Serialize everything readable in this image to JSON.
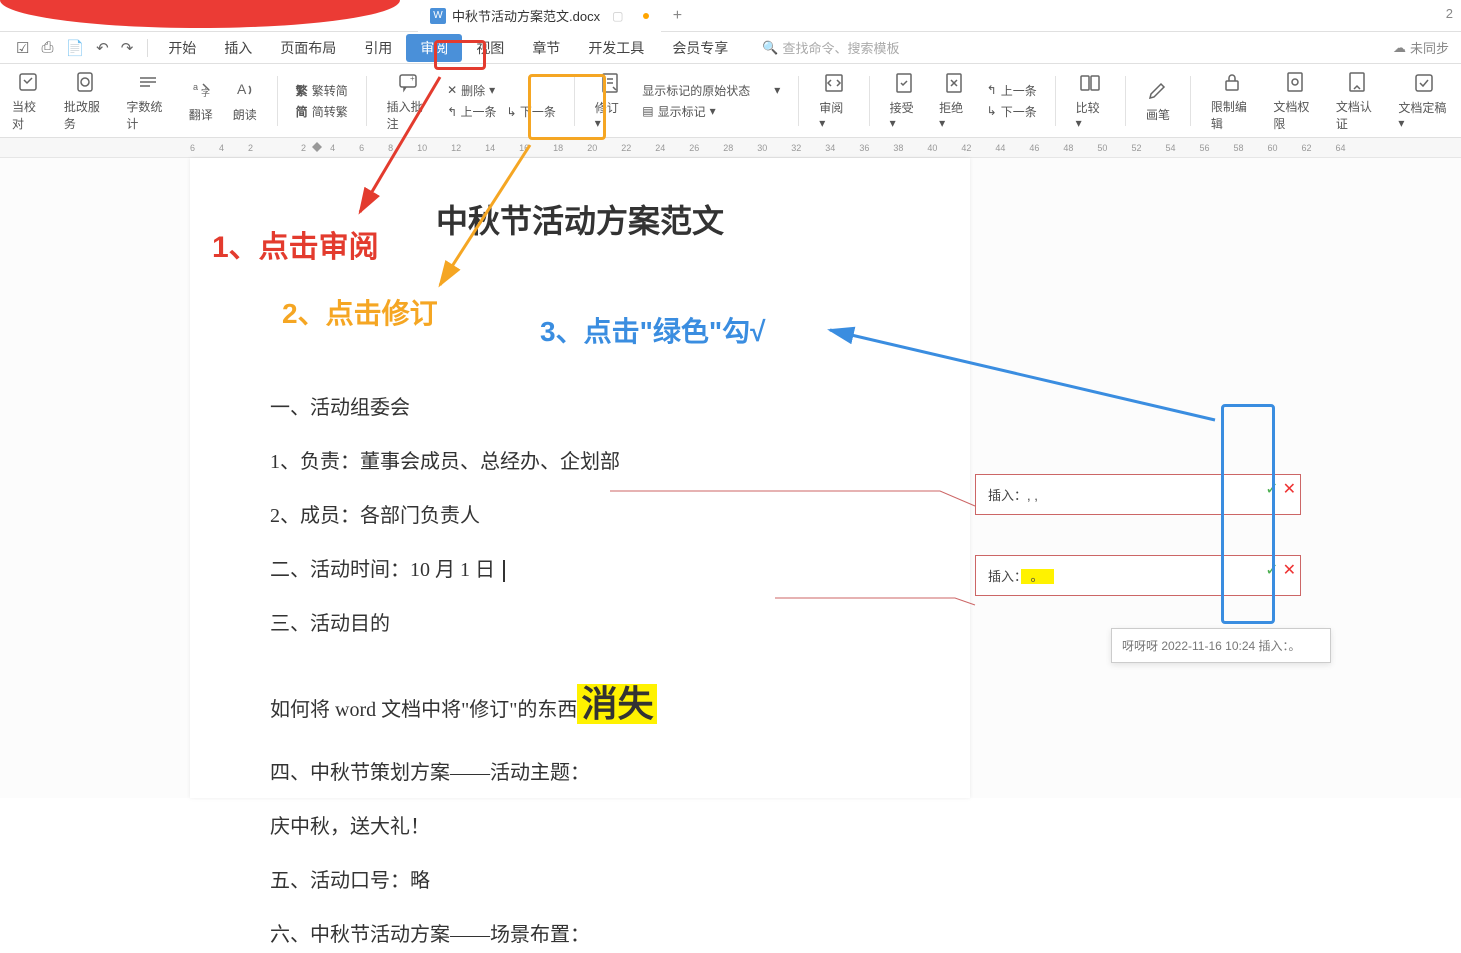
{
  "titlebar": {
    "doc_title": "中秋节活动方案范文.docx",
    "add_tab": "+"
  },
  "menubar": {
    "items": [
      "开始",
      "插入",
      "页面布局",
      "引用",
      "审阅",
      "视图",
      "章节",
      "开发工具",
      "会员专享"
    ],
    "search_placeholder": "查找命令、搜索模板",
    "sync": "未同步"
  },
  "toolbar": {
    "proofread": "当校对",
    "approval": "批改服务",
    "wordcount": "字数统计",
    "translate": "翻译",
    "read": "朗读",
    "fan_simple": "繁转简",
    "simple_fan": "简转繁",
    "fan_label": "繁",
    "jian_label": "简",
    "insert_comment": "插入批注",
    "delete": "删除",
    "prev": "上一条",
    "next": "下一条",
    "revise": "修订",
    "show_original": "显示标记的原始状态",
    "show_markup": "显示标记",
    "review": "审阅",
    "accept": "接受",
    "reject": "拒绝",
    "prev2": "上一条",
    "next2": "下一条",
    "compare": "比较",
    "pen": "画笔",
    "restrict": "限制编辑",
    "doc_perm": "文档权限",
    "doc_auth": "文档认证",
    "doc_finalize": "文档定稿"
  },
  "ruler": [
    "6",
    "4",
    "2",
    "",
    "2",
    "4",
    "6",
    "8",
    "10",
    "12",
    "14",
    "16",
    "18",
    "20",
    "22",
    "24",
    "26",
    "28",
    "30",
    "32",
    "34",
    "36",
    "38",
    "40",
    "42",
    "44",
    "46",
    "48",
    "50",
    "52",
    "54",
    "56",
    "58",
    "60",
    "62",
    "64"
  ],
  "annotations": {
    "step1": "1、点击审阅",
    "step2": "2、点击修订",
    "step3": "3、点击\"绿色\"勾√"
  },
  "document": {
    "title": "中秋节活动方案范文",
    "lines": {
      "l1": "一、活动组委会",
      "l2": "1、负责：董事会成员、总经办、企划部",
      "l3": "2、成员：各部门负责人",
      "l4": "二、活动时间：10 月 1 日",
      "l5": "三、活动目的",
      "l6a": "如何将 word 文档中将\"修订\"的东西",
      "l6b": "消失",
      "l7": "四、中秋节策划方案——活动主题：",
      "l8": "庆中秋，送大礼！",
      "l9": "五、活动口号：略",
      "l10": "六、中秋节活动方案——场景布置："
    }
  },
  "comments": {
    "c1": "插入：, ,",
    "c2_prefix": "插入：",
    "c2_highlight": "。",
    "tooltip": "呀呀呀 2022-11-16 10:24 插入：。"
  }
}
